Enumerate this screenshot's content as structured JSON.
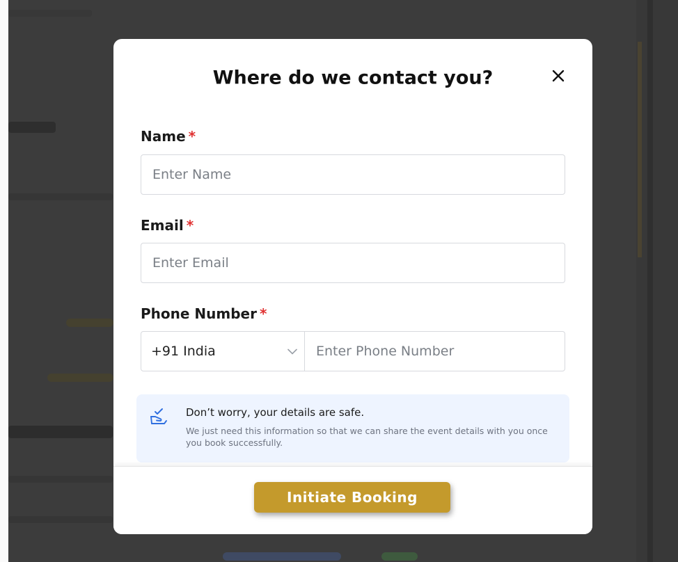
{
  "modal": {
    "title": "Where do we contact you?",
    "close_icon": "close-icon"
  },
  "form": {
    "name": {
      "label": "Name",
      "required_mark": "*",
      "placeholder": "Enter Name"
    },
    "email": {
      "label": "Email",
      "required_mark": "*",
      "placeholder": "Enter Email"
    },
    "phone": {
      "label": "Phone Number",
      "required_mark": "*",
      "country_code_value": "+91 India",
      "placeholder": "Enter Phone Number"
    }
  },
  "info": {
    "icon": "hand-check-icon",
    "title": "Don’t worry, your details are safe.",
    "body": "We just need this information so that we can share the event details with you once you book successfully."
  },
  "footer": {
    "submit_label": "Initiate Booking"
  },
  "colors": {
    "accent": "#c49a2c",
    "required": "#e03131",
    "info_bg": "#eef4ff",
    "icon_blue": "#2f6fe0"
  }
}
